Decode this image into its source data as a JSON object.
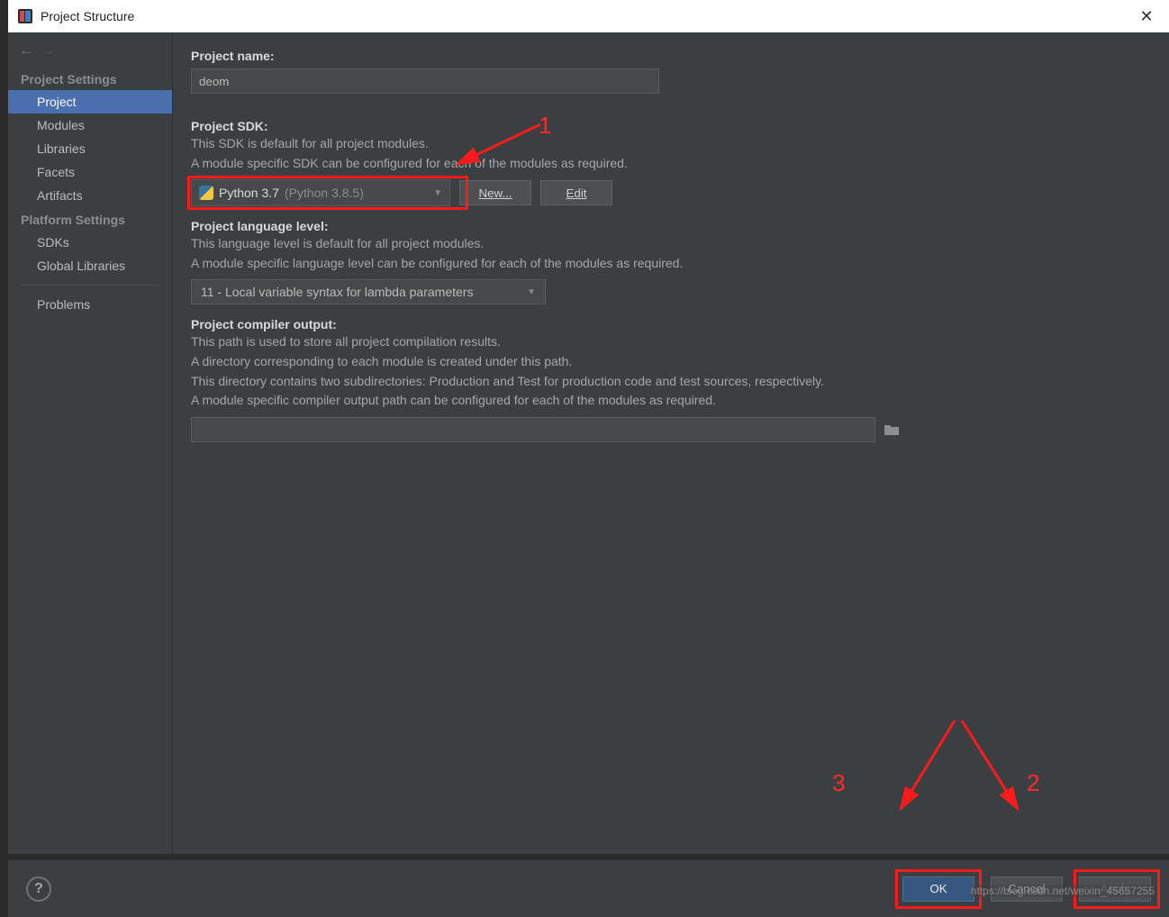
{
  "window": {
    "title": "Project Structure"
  },
  "sidebar": {
    "sections": {
      "project_settings": "Project Settings",
      "platform_settings": "Platform Settings"
    },
    "items": {
      "project": "Project",
      "modules": "Modules",
      "libraries": "Libraries",
      "facets": "Facets",
      "artifacts": "Artifacts",
      "sdks": "SDKs",
      "global_libs": "Global Libraries",
      "problems": "Problems"
    }
  },
  "project": {
    "name_label": "Project name:",
    "name_value": "deom",
    "sdk_label": "Project SDK:",
    "sdk_hint1": "This SDK is default for all project modules.",
    "sdk_hint2": "A module specific SDK can be configured for each of the modules as required.",
    "sdk_name": "Python 3.7",
    "sdk_detail": "(Python 3.8.5)",
    "new_btn": "New...",
    "edit_btn": "Edit",
    "lang_label": "Project language level:",
    "lang_hint1": "This language level is default for all project modules.",
    "lang_hint2": "A module specific language level can be configured for each of the modules as required.",
    "lang_value": "11 - Local variable syntax for lambda parameters",
    "output_label": "Project compiler output:",
    "output_hint1": "This path is used to store all project compilation results.",
    "output_hint2": "A directory corresponding to each module is created under this path.",
    "output_hint3": "This directory contains two subdirectories: Production and Test for production code and test sources, respectively.",
    "output_hint4": "A module specific compiler output path can be configured for each of the modules as required."
  },
  "footer": {
    "ok": "OK",
    "cancel": "Cancel",
    "apply": "Apply"
  },
  "annotations": {
    "n1": "1",
    "n2": "2",
    "n3": "3"
  },
  "watermark": "https://blog.csdn.net/weixin_45657255"
}
